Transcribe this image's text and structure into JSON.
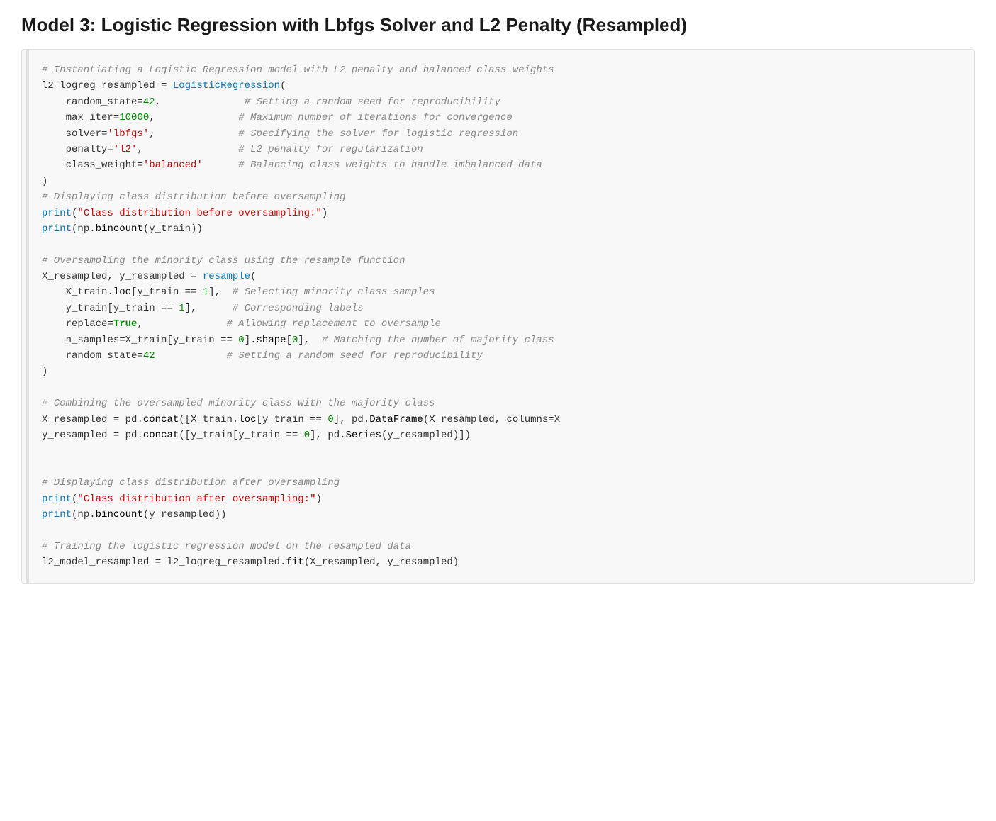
{
  "page": {
    "title": "Model 3: Logistic Regression with Lbfgs Solver and L2 Penalty (Resampled)"
  },
  "code_cell": {
    "lines": []
  }
}
